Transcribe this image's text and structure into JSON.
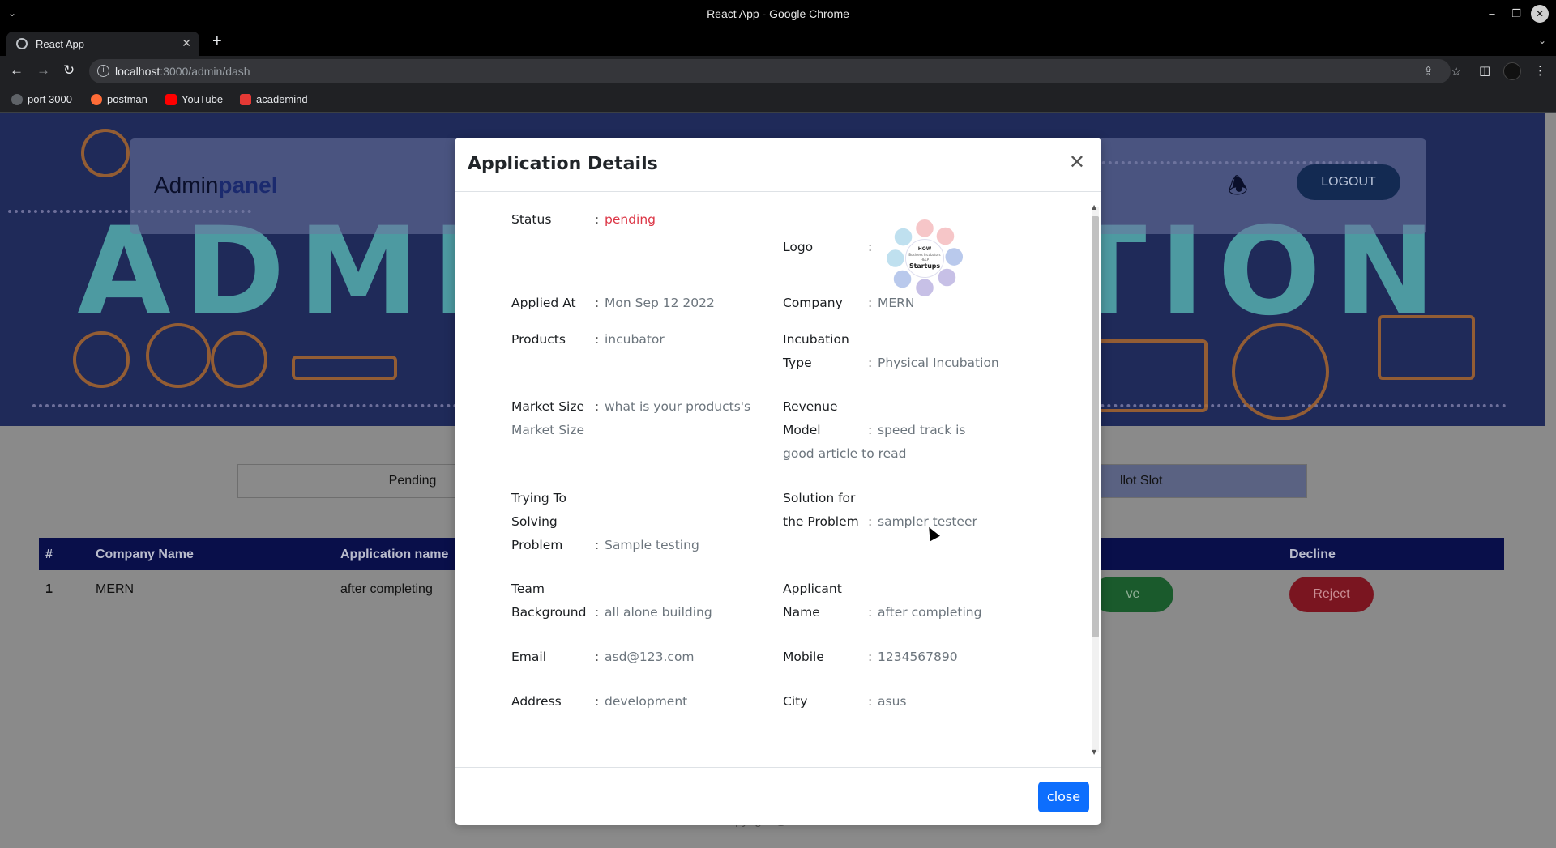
{
  "window": {
    "title": "React App - Google Chrome"
  },
  "browser": {
    "tab_title": "React App",
    "url_host": "localhost",
    "url_path": ":3000/admin/dash",
    "bookmarks": [
      {
        "label": "port 3000",
        "icon": "globe-icon",
        "color": "#bdc1c6"
      },
      {
        "label": "postman",
        "icon": "postman-icon",
        "color": "#ff6c37"
      },
      {
        "label": "YouTube",
        "icon": "youtube-icon",
        "color": "#ff0000"
      },
      {
        "label": "academind",
        "icon": "academind-icon",
        "color": "#e53935"
      }
    ]
  },
  "app": {
    "brand_prefix": "Admin",
    "brand_accent": "panel",
    "logout_label": "LOGOUT",
    "hero_word": "ADMINISTRATION",
    "tabs": [
      "Pending",
      "llot Slot"
    ],
    "table": {
      "headers": [
        "#",
        "Company Name",
        "Application name",
        "Decline"
      ],
      "row": {
        "index": "1",
        "company": "MERN",
        "application": "after completing",
        "approve": "ve",
        "reject": "Reject"
      }
    },
    "copyright": "Copyright @ 2022"
  },
  "modal": {
    "title": "Application Details",
    "close_label": "close",
    "logo_text": {
      "line1": "HOW",
      "line2": "Business Incubators",
      "line3": "HELP",
      "line4": "Startups"
    },
    "fields": {
      "status": {
        "label": "Status",
        "value": "pending"
      },
      "logo": {
        "label": "Logo"
      },
      "applied_at": {
        "label": "Applied At",
        "value": "Mon Sep 12 2022"
      },
      "company": {
        "label": "Company",
        "value": "MERN"
      },
      "products": {
        "label": "Products",
        "value": "incubator"
      },
      "incubation_type": {
        "label": "Incubation Type",
        "value": "Physical Incubation"
      },
      "market_size": {
        "label": "Market Size",
        "value": "what is your products's Market Size"
      },
      "revenue_model": {
        "label": "Revenue Model",
        "value": "speed track is good article to read"
      },
      "trying_to_solve": {
        "label": "Trying To Solving Problem",
        "value": "Sample testing"
      },
      "solution": {
        "label": "Solution for the Problem",
        "value": "sampler testeer"
      },
      "team_background": {
        "label": "Team Background",
        "value": "all alone building"
      },
      "applicant_name": {
        "label": "Applicant Name",
        "value": "after completing"
      },
      "email": {
        "label": "Email",
        "value": "asd@123.com"
      },
      "mobile": {
        "label": "Mobile",
        "value": "1234567890"
      },
      "address": {
        "label": "Address",
        "value": "development"
      },
      "city": {
        "label": "City",
        "value": "asus"
      }
    },
    "colon": ":"
  },
  "colors": {
    "status_pending": "#dc3545",
    "primary_button": "#0d6efd",
    "table_header": "#090f4a"
  }
}
